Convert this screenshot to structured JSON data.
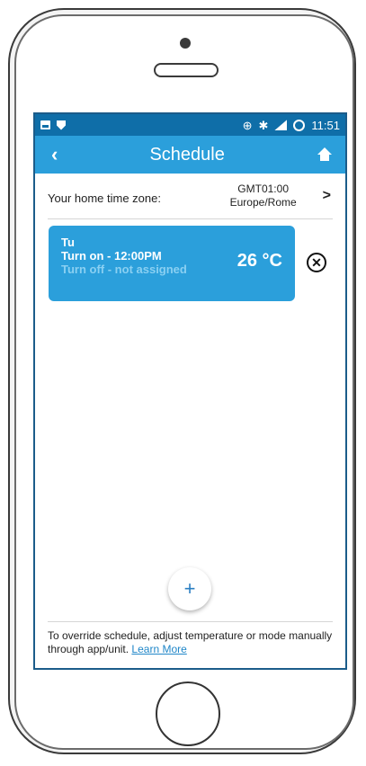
{
  "status_bar": {
    "time": "11:51",
    "icons": [
      "image-icon",
      "shield-icon",
      "sync-icon",
      "bluetooth-icon",
      "signal-icon",
      "battery-icon"
    ]
  },
  "app_bar": {
    "back_icon": "chevron-left-icon",
    "back_glyph": "‹",
    "title": "Schedule",
    "home_icon": "home-icon"
  },
  "timezone": {
    "label": "Your home time zone:",
    "offset": "GMT01:00",
    "region": "Europe/Rome",
    "chevron": ">"
  },
  "schedules": [
    {
      "day": "Tu",
      "turn_on": "Turn on - 12:00PM",
      "turn_off": "Turn off - not assigned",
      "temperature": "26 °C",
      "remove_glyph": "✕"
    }
  ],
  "add_button": {
    "glyph": "+"
  },
  "footer": {
    "text": "To override schedule, adjust temperature or mode manually through app/unit.",
    "link": "Learn More"
  },
  "colors": {
    "status_bar": "#0f6ea8",
    "app_bar": "#2b9fdb",
    "card": "#2b9fdb",
    "card_muted_text": "#8ad0f2",
    "link": "#1f86c8"
  }
}
